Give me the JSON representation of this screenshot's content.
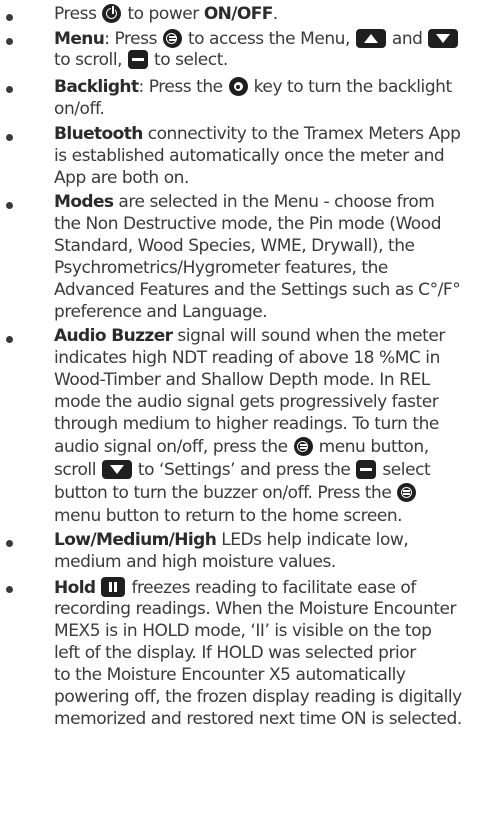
{
  "icons": {
    "power": "power-icon",
    "menu": "menu-icon",
    "up": "up-arrow-icon",
    "down": "down-arrow-icon",
    "select": "select-icon",
    "backlight": "backlight-icon",
    "hold": "hold-icon"
  },
  "items": {
    "power": {
      "t1": "Press",
      "t2": "to power",
      "bold": "ON/OFF",
      "t3": "."
    },
    "menu": {
      "bold": "Menu",
      "t1": ": Press",
      "t2": "to access the Menu,",
      "t3": "and",
      "t4": "to scroll,",
      "t5": "to select."
    },
    "backlight": {
      "bold": "Backlight",
      "t1": ": Press the",
      "t2": "key to turn the backlight",
      "t3": "on/off."
    },
    "bluetooth": {
      "bold": "Bluetooth",
      "t1": "connectivity to the Tramex Meters App",
      "l2": "is established automatically once the meter and",
      "l3": "App are both on."
    },
    "modes": {
      "bold": "Modes",
      "t1": "are selected in the Menu - choose from",
      "l2": "the Non Destructive mode, the Pin mode (Wood",
      "l3": "Standard, Wood Species, WME, Drywall), the",
      "l4": "Psychrometrics/Hygrometer features, the",
      "l5": "Advanced Features and the Settings such as C°/F°",
      "l6": "preference and Language."
    },
    "audio": {
      "bold": "Audio Buzzer",
      "t1": "signal will sound when the meter",
      "l2": "indicates high NDT reading of above 18 %MC in",
      "l3": "Wood-Timber and Shallow Depth mode. In REL",
      "l4": "mode the audio signal gets progressively faster",
      "l5": "through medium to higher readings. To turn the",
      "l6a": "audio signal on/off, press the",
      "l6b": "menu button,",
      "l7a": "scroll",
      "l7b": "to ‘Settings’ and press the",
      "l7c": "select",
      "l8a": "button to turn the buzzer on/off. Press the",
      "l9": "menu button to return to the home screen."
    },
    "leds": {
      "bold": "Low/Medium/High",
      "t1": "LEDs help indicate low,",
      "l2": "medium and high moisture values."
    },
    "hold": {
      "bold": "Hold",
      "t1": "freezes reading to facilitate ease of",
      "l2": "recording readings. When the Moisture Encounter",
      "l3": "MEX5 is in HOLD mode, ‘II’ is visible on the top",
      "l4": "left of the display. If HOLD was selected prior",
      "l5": "to the Moisture Encounter X5 automatically",
      "l6": "powering off, the frozen display reading is digitally",
      "l7": "memorized and restored next time ON is selected."
    }
  }
}
